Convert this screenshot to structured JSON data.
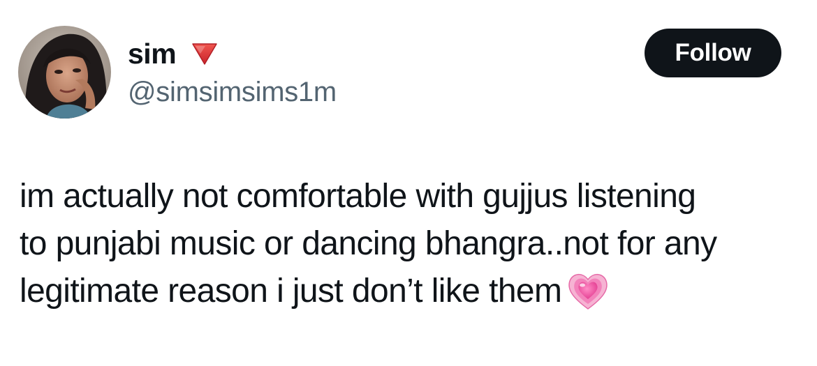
{
  "author": {
    "display_name": "sim",
    "name_emoji": "red-triangle-pointed-down-icon",
    "handle": "@simsimsims1m"
  },
  "follow_button": {
    "label": "Follow"
  },
  "tweet": {
    "lines": [
      "im actually not comfortable with gujjus listening",
      "to punjabi music or dancing bhangra..not for any",
      "legitimate reason i just don’t like them"
    ],
    "trailing_emoji": "growing-heart-icon"
  },
  "colors": {
    "text_primary": "#0f1419",
    "text_secondary": "#536471",
    "button_bg": "#0f1419",
    "button_text": "#ffffff",
    "emoji_red": "#e0313a",
    "heart_pink": "#ef5fa7"
  }
}
